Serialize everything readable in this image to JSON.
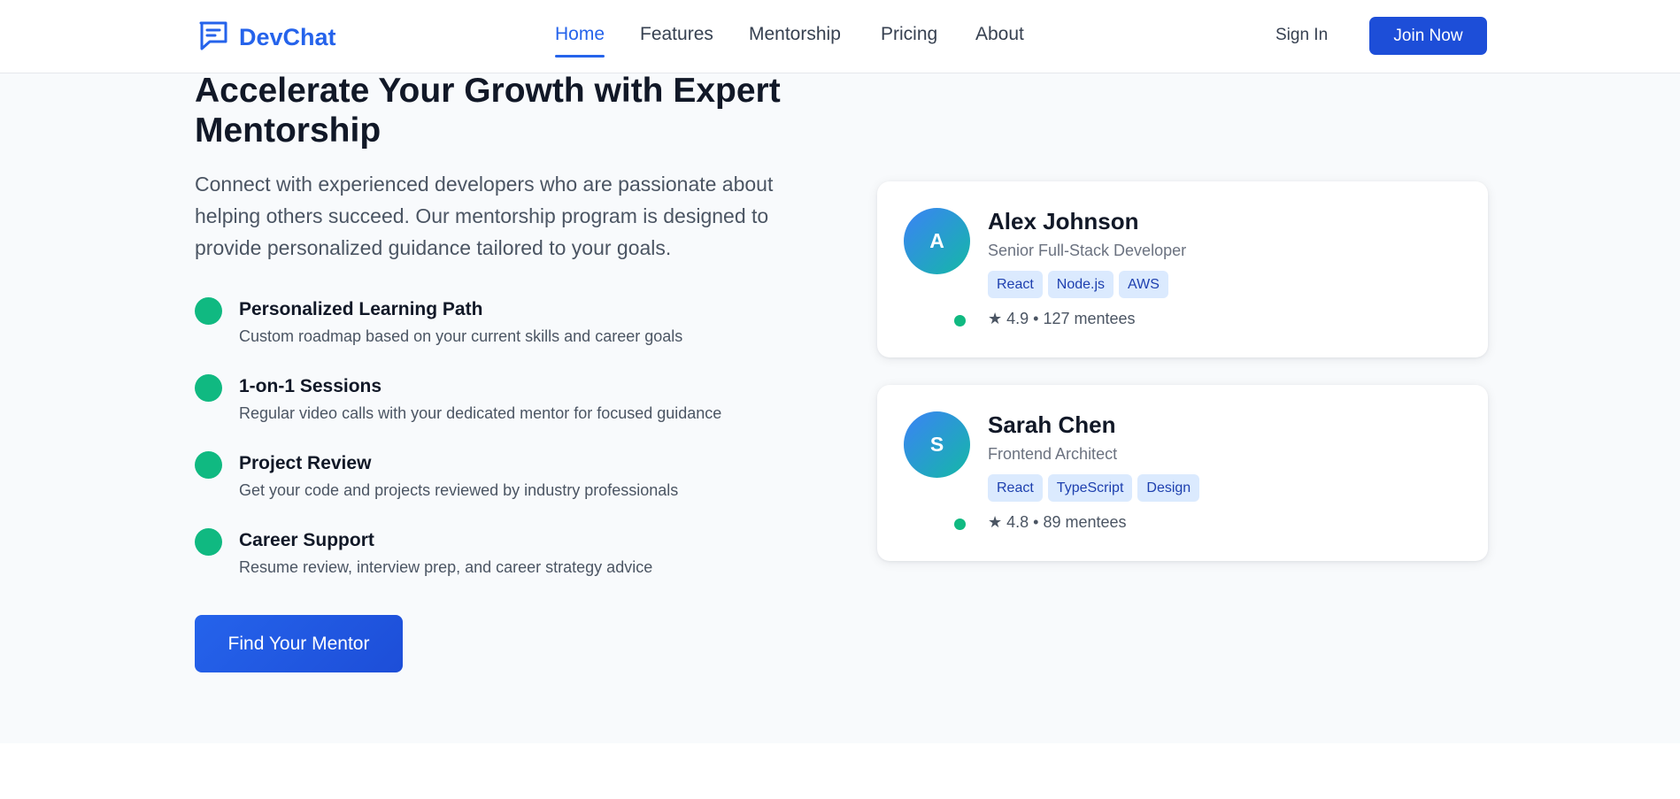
{
  "brand": {
    "name": "DevChat",
    "icon": "chat-bubble-icon",
    "color": "#2563eb"
  },
  "nav": {
    "items": [
      {
        "label": "Home",
        "active": true
      },
      {
        "label": "Features",
        "active": false
      },
      {
        "label": "Mentorship",
        "active": false
      },
      {
        "label": "Pricing",
        "active": false
      },
      {
        "label": "About",
        "active": false
      }
    ]
  },
  "header": {
    "sign_in_label": "Sign In",
    "join_label": "Join Now"
  },
  "hero": {
    "title": "Accelerate Your Growth with Expert Mentorship",
    "description": "Connect with experienced developers who are passionate about helping others succeed. Our mentorship program is designed to provide personalized guidance tailored to your goals.",
    "cta_label": "Find Your Mentor"
  },
  "features": [
    {
      "title": "Personalized Learning Path",
      "description": "Custom roadmap based on your current skills and career goals"
    },
    {
      "title": "1-on-1 Sessions",
      "description": "Regular video calls with your dedicated mentor for focused guidance"
    },
    {
      "title": "Project Review",
      "description": "Get your code and projects reviewed by industry professionals"
    },
    {
      "title": "Career Support",
      "description": "Resume review, interview prep, and career strategy advice"
    }
  ],
  "mentors": [
    {
      "initial": "A",
      "name": "Alex Johnson",
      "role": "Senior Full-Stack Developer",
      "tags": [
        "React",
        "Node.js",
        "AWS"
      ],
      "stats": "★ 4.9 • 127 mentees"
    },
    {
      "initial": "S",
      "name": "Sarah Chen",
      "role": "Frontend Architect",
      "tags": [
        "React",
        "TypeScript",
        "Design"
      ],
      "stats": "★ 4.8 • 89 mentees"
    }
  ],
  "colors": {
    "accent": "#2563eb",
    "success": "#10b981",
    "tag_bg": "#dbeafe",
    "tag_text": "#1e40af"
  }
}
